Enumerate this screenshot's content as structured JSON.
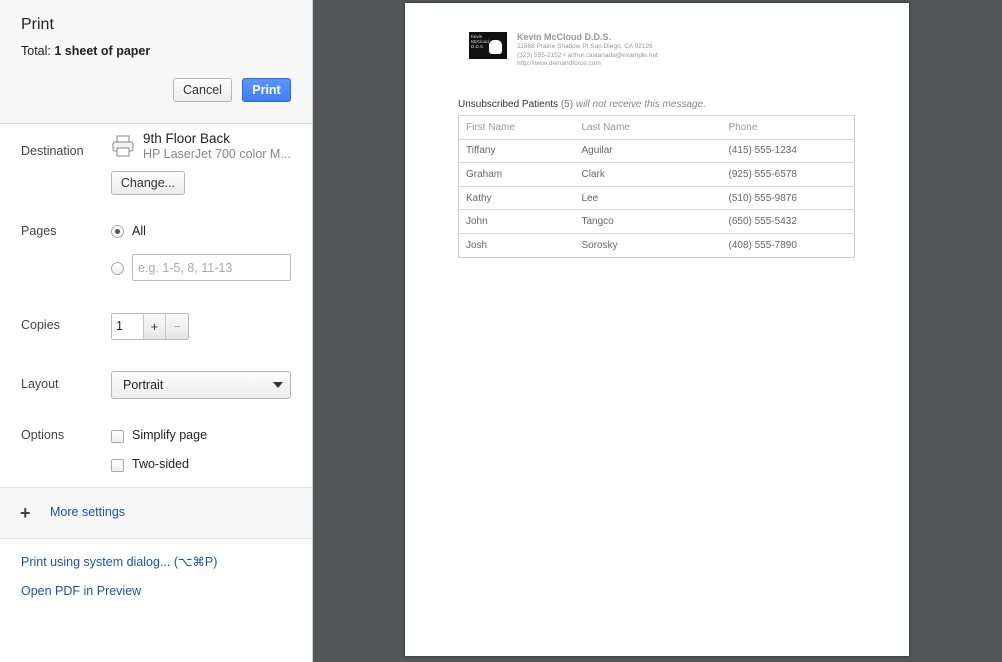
{
  "header": {
    "title": "Print",
    "total_label": "Total:",
    "total_value": "1 sheet of paper",
    "cancel_label": "Cancel",
    "print_label": "Print"
  },
  "destination": {
    "label": "Destination",
    "printer_name": "9th Floor Back",
    "printer_model": "HP LaserJet 700 color M...",
    "change_label": "Change...",
    "icon": "printer-icon"
  },
  "pages": {
    "label": "Pages",
    "all_label": "All",
    "selected": "All",
    "range_placeholder": "e.g. 1-5, 8, 11-13"
  },
  "copies": {
    "label": "Copies",
    "value": "1",
    "plus": "+",
    "minus": "−"
  },
  "layout": {
    "label": "Layout",
    "value": "Portrait"
  },
  "options": {
    "label": "Options",
    "simplify_label": "Simplify page",
    "simplify_checked": false,
    "two_sided_label": "Two-sided",
    "two_sided_checked": false
  },
  "more_settings": {
    "icon": "plus",
    "label": "More settings"
  },
  "links": {
    "system_dialog": "Print using system dialog... (⌥⌘P)",
    "open_pdf": "Open PDF in Preview"
  },
  "document": {
    "logo_text": "Kevin McCloud D.D.S.",
    "practice_name": "Kevin McCloud D.D.S.",
    "address": "11568 Prairie Shadow Pt San Diego, CA 92126",
    "contact": "(323) 555-2152 • arthur.castanada@example.net",
    "website": "http://www.demandforce.com",
    "section_title": "Unsubscribed Patients",
    "section_count": "(5)",
    "section_note": "will not receive this message.",
    "columns": [
      "First Name",
      "Last Name",
      "Phone"
    ],
    "rows": [
      [
        "Tiffany",
        "Aguilar",
        "(415) 555-1234"
      ],
      [
        "Graham",
        "Clark",
        "(925) 555-6578"
      ],
      [
        "Kathy",
        "Lee",
        "(510) 555-9876"
      ],
      [
        "John",
        "Tangco",
        "(650) 555-5432"
      ],
      [
        "Josh",
        "Sorosky",
        "(408) 555-7890"
      ]
    ]
  },
  "colors": {
    "preview_background": "#525659",
    "print_button": "#4285f4",
    "link": "#1e50b4"
  }
}
